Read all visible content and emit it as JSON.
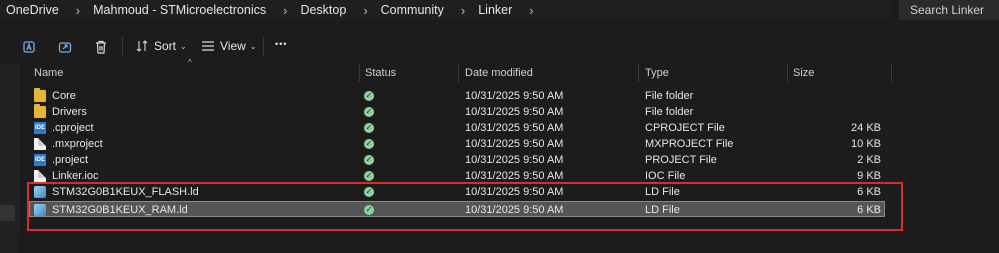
{
  "address_bar": {
    "crumbs": [
      "OneDrive",
      "Mahmoud - STMicroelectronics",
      "Desktop",
      "Community",
      "Linker"
    ],
    "separator": "›"
  },
  "search": {
    "placeholder": "Search Linker"
  },
  "toolbar": {
    "sort_label": "Sort",
    "view_label": "View",
    "more_label": "•••"
  },
  "columns": {
    "name": "Name",
    "status": "Status",
    "date": "Date modified",
    "type": "Type",
    "size": "Size"
  },
  "files": [
    {
      "name": "Core",
      "icon": "folder-icon",
      "status": "synced",
      "date": "10/31/2025 9:50 AM",
      "type": "File folder",
      "size": ""
    },
    {
      "name": "Drivers",
      "icon": "folder-icon",
      "status": "synced",
      "date": "10/31/2025 9:50 AM",
      "type": "File folder",
      "size": ""
    },
    {
      "name": ".cproject",
      "icon": "ide-file-icon",
      "status": "synced",
      "date": "10/31/2025 9:50 AM",
      "type": "CPROJECT File",
      "size": "24 KB"
    },
    {
      "name": ".mxproject",
      "icon": "document-icon",
      "status": "synced",
      "date": "10/31/2025 9:50 AM",
      "type": "MXPROJECT File",
      "size": "10 KB"
    },
    {
      "name": ".project",
      "icon": "ide-file-icon",
      "status": "synced",
      "date": "10/31/2025 9:50 AM",
      "type": "PROJECT File",
      "size": "2 KB"
    },
    {
      "name": "Linker.ioc",
      "icon": "document-icon",
      "status": "synced",
      "date": "10/31/2025 9:50 AM",
      "type": "IOC File",
      "size": "9 KB"
    },
    {
      "name": "STM32G0B1KEUX_FLASH.ld",
      "icon": "ld-file-icon",
      "status": "synced",
      "date": "10/31/2025 9:50 AM",
      "type": "LD File",
      "size": "6 KB"
    },
    {
      "name": "STM32G0B1KEUX_RAM.ld",
      "icon": "ld-file-icon",
      "status": "synced",
      "date": "10/31/2025 9:50 AM",
      "type": "LD File",
      "size": "6 KB"
    }
  ],
  "selected_row_index": 7,
  "colors": {
    "highlight_border": "#e02a2a",
    "folder": "#e8b53a",
    "status_ok": "#8fd19e",
    "background": "#1c1c1c"
  }
}
